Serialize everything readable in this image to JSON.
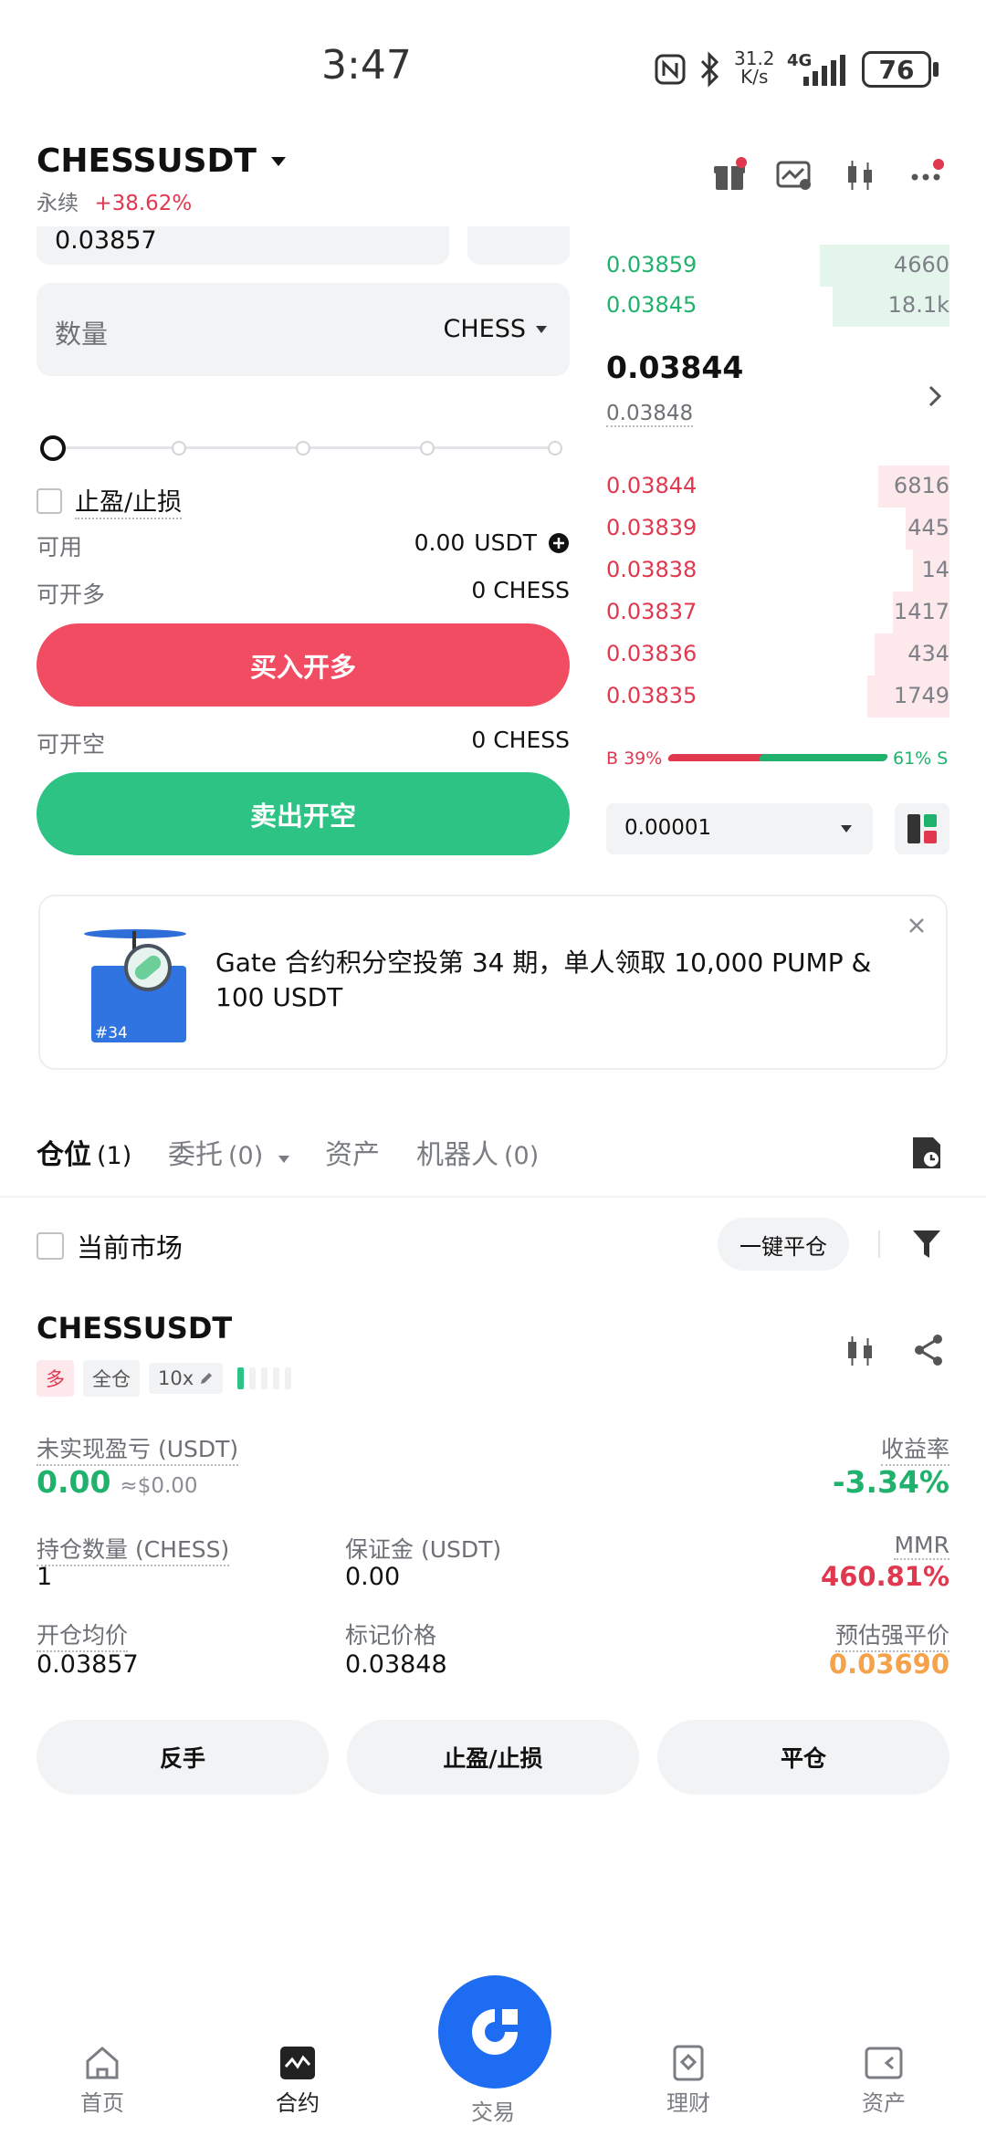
{
  "status_bar": {
    "time": "3:47",
    "net_speed_top": "31.2",
    "net_speed_bottom": "K/s",
    "network": "4G",
    "battery": "76"
  },
  "header": {
    "symbol": "CHESSUSDT",
    "market_type": "永续",
    "change": "+38.62%"
  },
  "order_form": {
    "price_value": "0.03857",
    "quantity_placeholder": "数量",
    "quantity_unit": "CHESS",
    "tpsl_label": "止盈/止损",
    "available_label": "可用",
    "available_value": "0.00",
    "available_unit": "USDT",
    "can_long_label": "可开多",
    "can_long_value": "0 CHESS",
    "buy_button": "买入开多",
    "can_short_label": "可开空",
    "can_short_value": "0 CHESS",
    "sell_button": "卖出开空"
  },
  "order_book": {
    "asks": [
      {
        "price": "0.03859",
        "size": "4660",
        "depth": 0.26
      },
      {
        "price": "0.03845",
        "size": "18.1k",
        "depth": 0.23
      }
    ],
    "last_price": "0.03844",
    "mark_price": "0.03848",
    "bids": [
      {
        "price": "0.03844",
        "size": "6816",
        "depth": 0.14
      },
      {
        "price": "0.03839",
        "size": "445",
        "depth": 0.1
      },
      {
        "price": "0.03838",
        "size": "14",
        "depth": 0.08
      },
      {
        "price": "0.03837",
        "size": "1417",
        "depth": 0.12
      },
      {
        "price": "0.03836",
        "size": "434",
        "depth": 0.16
      },
      {
        "price": "0.03835",
        "size": "1749",
        "depth": 0.18
      }
    ],
    "buy_ratio_label": "B 39%",
    "sell_ratio_label": "61% S",
    "buy_ratio": 0.39,
    "precision": "0.00001"
  },
  "banner": {
    "text": "Gate 合约积分空投第 34 期，单人领取 10,000 PUMP & 100 USDT",
    "badge": "#34"
  },
  "tabs": [
    {
      "label": "仓位",
      "count": "(1)"
    },
    {
      "label": "委托",
      "count": "(0)"
    },
    {
      "label": "资产",
      "count": ""
    },
    {
      "label": "机器人",
      "count": "(0)"
    }
  ],
  "filter": {
    "current_market": "当前市场",
    "close_all": "一键平仓"
  },
  "position": {
    "symbol": "CHESSUSDT",
    "side": "多",
    "margin_mode": "全仓",
    "leverage": "10x",
    "unrealized_pnl_label": "未实现盈亏 (USDT)",
    "unrealized_pnl": "0.00",
    "unrealized_pnl_usd": "≈$0.00",
    "roe_label": "收益率",
    "roe": "-3.34%",
    "size_label": "持仓数量 (CHESS)",
    "size": "1",
    "margin_label": "保证金 (USDT)",
    "margin": "0.00",
    "mmr_label": "MMR",
    "mmr": "460.81%",
    "entry_label": "开仓均价",
    "entry": "0.03857",
    "mark_label": "标记价格",
    "mark": "0.03848",
    "liq_label": "预估强平价",
    "liq": "0.03690",
    "reverse_button": "反手",
    "tpsl_button": "止盈/止损",
    "close_button": "平仓"
  },
  "bottom_nav": [
    {
      "label": "首页"
    },
    {
      "label": "合约"
    },
    {
      "label": "交易"
    },
    {
      "label": "理财"
    },
    {
      "label": "资产"
    }
  ],
  "colors": {
    "green": "#20b26c",
    "red": "#e0384f",
    "buy_button": "#f24c62",
    "sell_button": "#2cc384",
    "accent_blue": "#1d6cf2"
  }
}
